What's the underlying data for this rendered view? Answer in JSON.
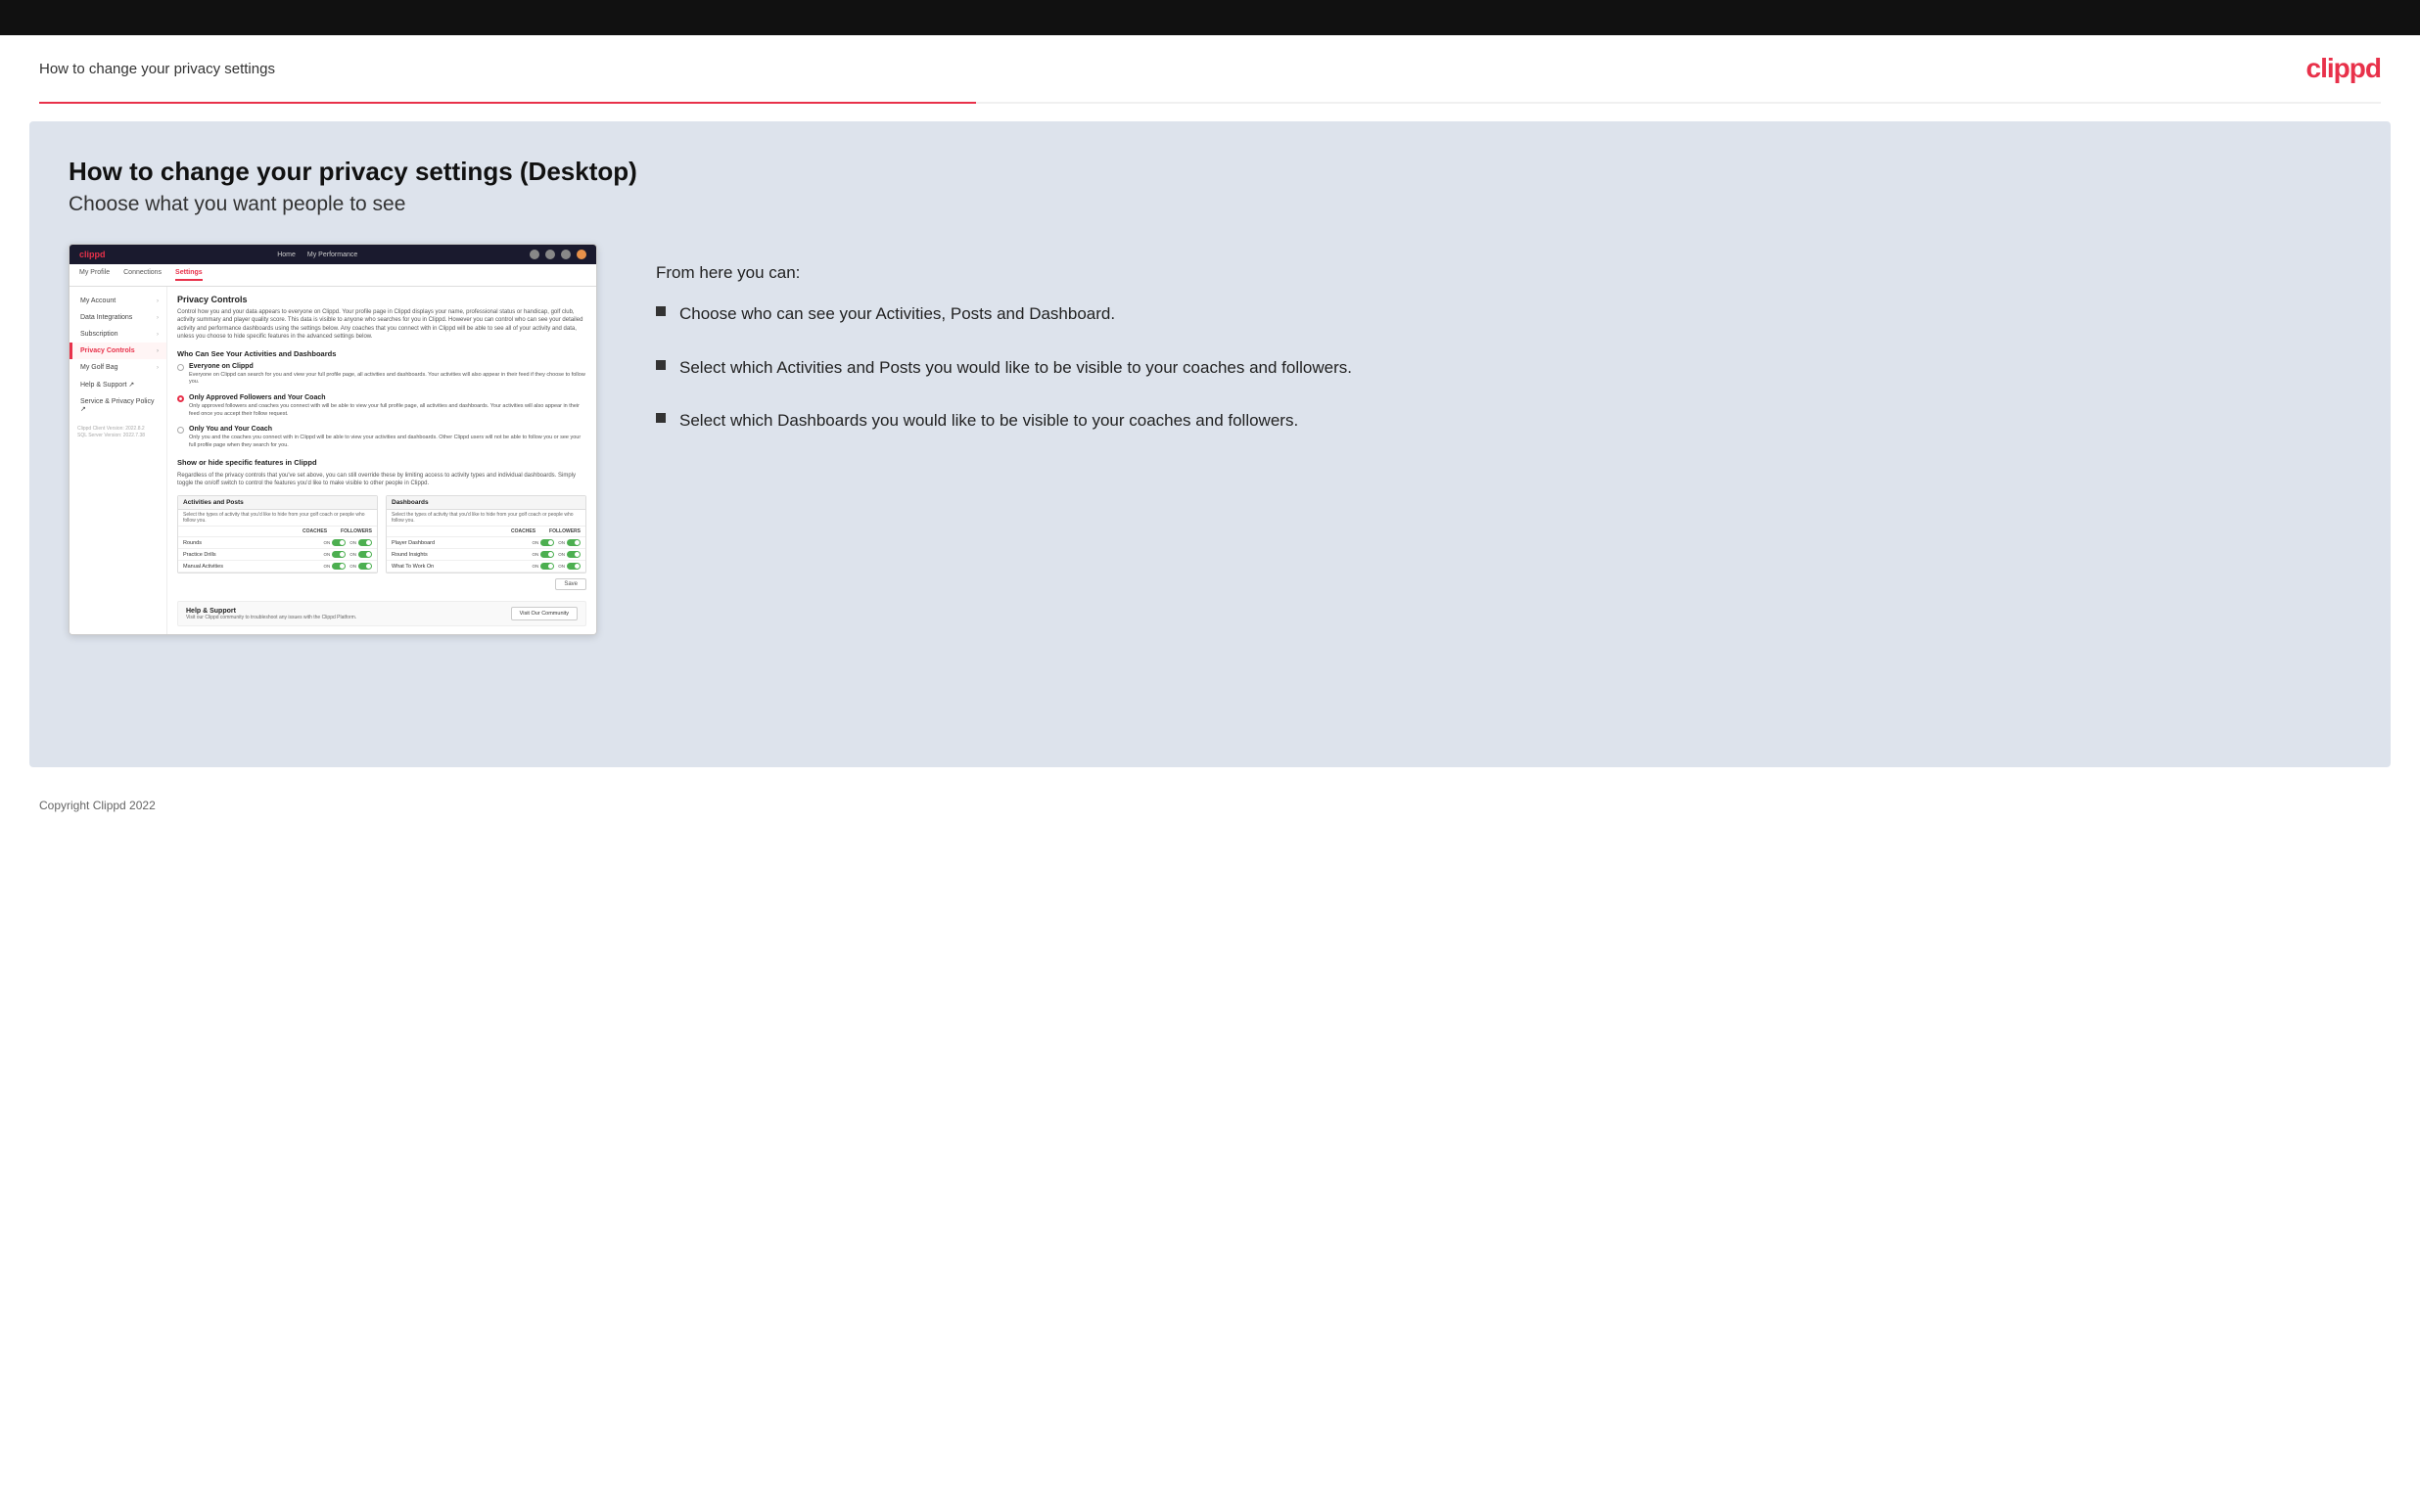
{
  "topbar": {},
  "header": {
    "title": "How to change your privacy settings",
    "logo": "clippd"
  },
  "main": {
    "heading": "How to change your privacy settings (Desktop)",
    "subheading": "Choose what you want people to see",
    "from_here_label": "From here you can:",
    "bullets": [
      {
        "text": "Choose who can see your Activities, Posts and Dashboard."
      },
      {
        "text": "Select which Activities and Posts you would like to be visible to your coaches and followers."
      },
      {
        "text": "Select which Dashboards you would like to be visible to your coaches and followers."
      }
    ]
  },
  "mockup": {
    "logo": "clippd",
    "nav": {
      "home": "Home",
      "my_performance": "My Performance"
    },
    "subnav": {
      "my_profile": "My Profile",
      "connections": "Connections",
      "settings": "Settings"
    },
    "sidebar": {
      "items": [
        {
          "label": "My Account",
          "active": false
        },
        {
          "label": "Data Integrations",
          "active": false
        },
        {
          "label": "Subscription",
          "active": false
        },
        {
          "label": "Privacy Controls",
          "active": true
        },
        {
          "label": "My Golf Bag",
          "active": false
        },
        {
          "label": "Help & Support",
          "active": false
        },
        {
          "label": "Service & Privacy Policy",
          "active": false
        }
      ],
      "version": "Clippd Client Version: 2022.8.2\nSQL Server Version: 2022.7.38"
    },
    "panel": {
      "section_title": "Privacy Controls",
      "section_desc": "Control how you and your data appears to everyone on Clippd. Your profile page in Clippd displays your name, professional status or handicap, golf club, activity summary and player quality score. This data is visible to anyone who searches for you in Clippd. However you can control who can see your detailed activity and performance dashboards using the settings below. Any coaches that you connect with in Clippd will be able to see all of your activity and data, unless you choose to hide specific features in the advanced settings below.",
      "who_can_see_title": "Who Can See Your Activities and Dashboards",
      "radio_options": [
        {
          "label": "Everyone on Clippd",
          "desc": "Everyone on Clippd can search for you and view your full profile page, all activities and dashboards. Your activities will also appear in their feed if they choose to follow you.",
          "selected": false
        },
        {
          "label": "Only Approved Followers and Your Coach",
          "desc": "Only approved followers and coaches you connect with will be able to view your full profile page, all activities and dashboards. Your activities will also appear in their feed once you accept their follow request.",
          "selected": true
        },
        {
          "label": "Only You and Your Coach",
          "desc": "Only you and the coaches you connect with in Clippd will be able to view your activities and dashboards. Other Clippd users will not be able to follow you or see your full profile page when they search for you.",
          "selected": false
        }
      ],
      "show_hide_title": "Show or hide specific features in Clippd",
      "show_hide_desc": "Regardless of the privacy controls that you've set above, you can still override these by limiting access to activity types and individual dashboards. Simply toggle the on/off switch to control the features you'd like to make visible to other people in Clippd.",
      "activities_table": {
        "title": "Activities and Posts",
        "desc": "Select the types of activity that you'd like to hide from your golf coach or people who follow you.",
        "col_coaches": "COACHES",
        "col_followers": "FOLLOWERS",
        "rows": [
          {
            "label": "Rounds"
          },
          {
            "label": "Practice Drills"
          },
          {
            "label": "Manual Activities"
          }
        ]
      },
      "dashboards_table": {
        "title": "Dashboards",
        "desc": "Select the types of activity that you'd like to hide from your golf coach or people who follow you.",
        "col_coaches": "COACHES",
        "col_followers": "FOLLOWERS",
        "rows": [
          {
            "label": "Player Dashboard"
          },
          {
            "label": "Round Insights"
          },
          {
            "label": "What To Work On"
          }
        ]
      },
      "save_button": "Save",
      "help_section": {
        "title": "Help & Support",
        "desc": "Visit our Clippd community to troubleshoot any issues with the Clippd Platform.",
        "visit_btn": "Visit Our Community"
      }
    }
  },
  "footer": {
    "copyright": "Copyright Clippd 2022"
  }
}
